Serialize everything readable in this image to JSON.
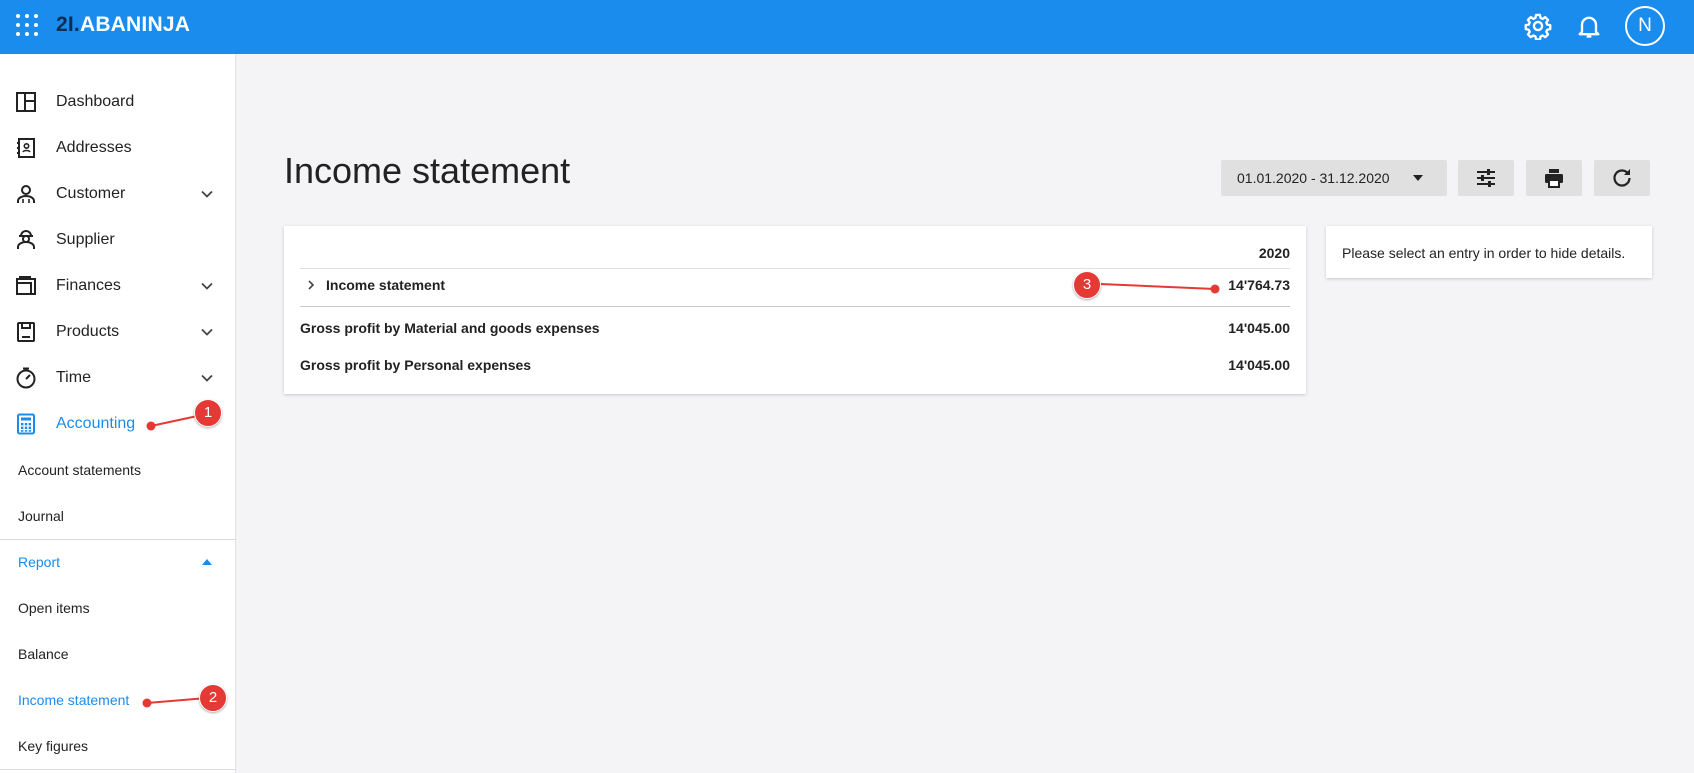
{
  "app": {
    "brand_mark": "2I.",
    "brand_name": "ABANINJA",
    "user_initial": "N"
  },
  "sidebar": {
    "items": [
      {
        "label": "Dashboard",
        "icon": "dashboard-icon"
      },
      {
        "label": "Addresses",
        "icon": "address-book-icon"
      },
      {
        "label": "Customer",
        "icon": "customer-icon",
        "expandable": true
      },
      {
        "label": "Supplier",
        "icon": "supplier-icon"
      },
      {
        "label": "Finances",
        "icon": "wallet-icon",
        "expandable": true
      },
      {
        "label": "Products",
        "icon": "product-icon",
        "expandable": true
      },
      {
        "label": "Time",
        "icon": "stopwatch-icon",
        "expandable": true
      },
      {
        "label": "Accounting",
        "icon": "calculator-icon",
        "active": true
      }
    ],
    "accounting_items": [
      {
        "label": "Account statements"
      },
      {
        "label": "Journal"
      }
    ],
    "report_section": {
      "label": "Report",
      "expanded": true
    },
    "report_items": [
      {
        "label": "Open items"
      },
      {
        "label": "Balance"
      },
      {
        "label": "Income statement",
        "active": true
      },
      {
        "label": "Key figures"
      }
    ]
  },
  "main": {
    "title": "Income statement",
    "date_range": "01.01.2020 - 31.12.2020",
    "table": {
      "year_header": "2020",
      "rows": [
        {
          "label": "Income statement",
          "value": "14'764.73",
          "expandable": true
        },
        {
          "label": "Gross profit by Material and goods expenses",
          "value": "14'045.00"
        },
        {
          "label": "Gross profit by Personal expenses",
          "value": "14'045.00"
        }
      ]
    },
    "detail_text": "Please select an entry in order to hide details."
  },
  "annotations": [
    {
      "number": "1"
    },
    {
      "number": "2"
    },
    {
      "number": "3"
    }
  ],
  "colors": {
    "brand_blue": "#1a8cee",
    "annotation_red": "#e53935"
  }
}
